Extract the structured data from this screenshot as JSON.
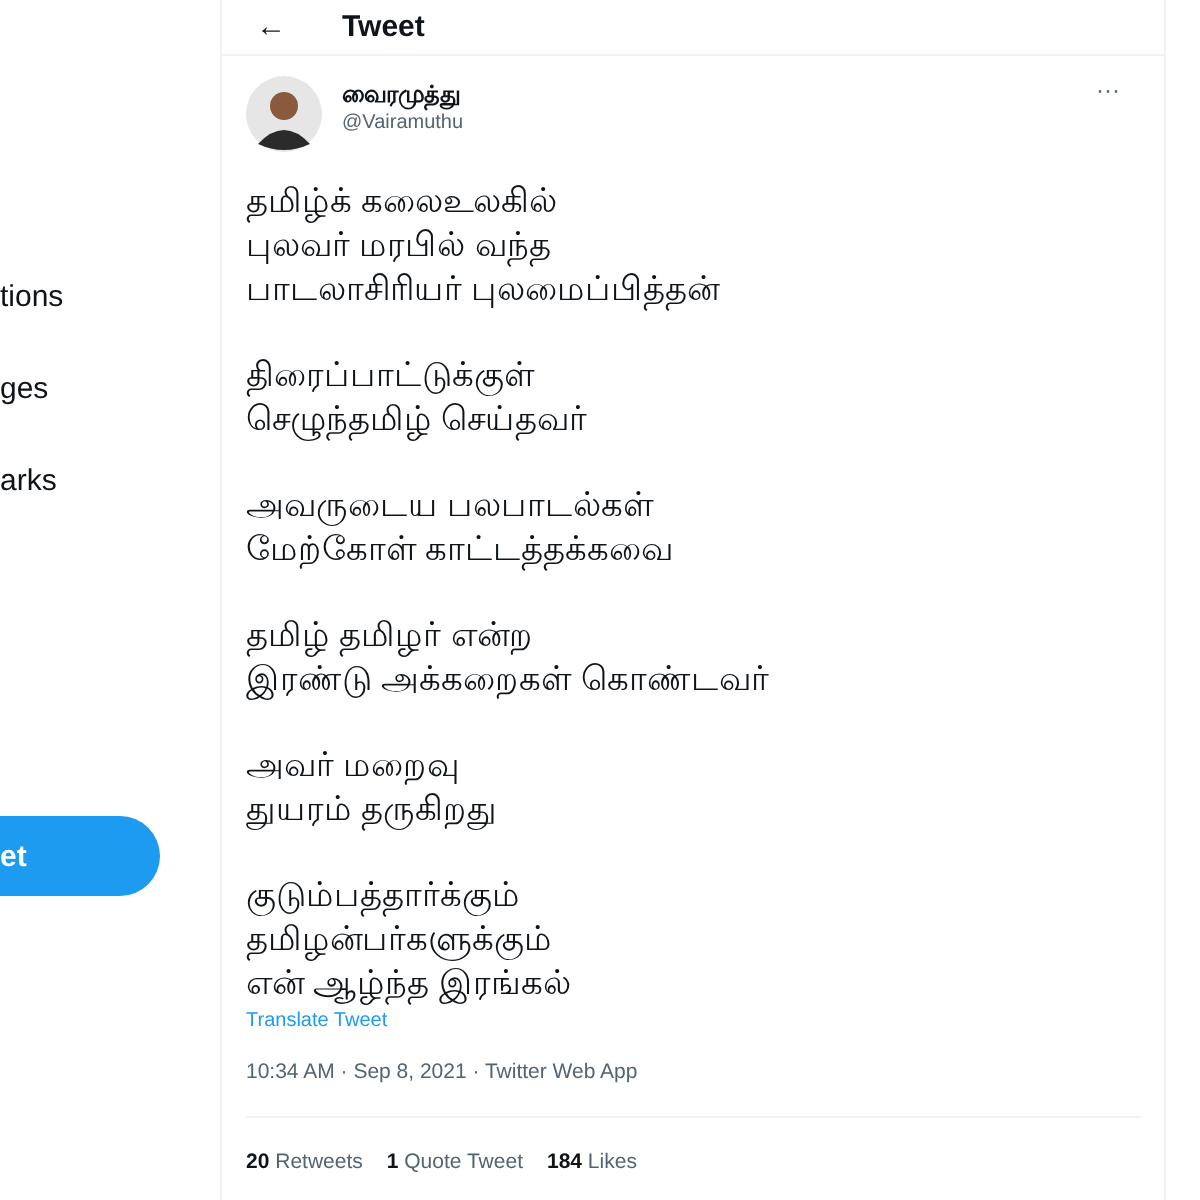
{
  "sidebar": {
    "items": [
      {
        "label": "tions"
      },
      {
        "label": "ges"
      },
      {
        "label": "arks"
      }
    ],
    "tweet_button": "et"
  },
  "header": {
    "back_icon": "←",
    "title": "Tweet"
  },
  "tweet": {
    "author_name": "வைரமுத்து",
    "handle": "@Vairamuthu",
    "more": "···",
    "paragraphs": [
      [
        "தமிழ்க் கலைஉலகில்",
        "புலவர் மரபில் வந்த",
        "பாடலாசிரியர் புலமைப்பித்தன்"
      ],
      [
        "திரைப்பாட்டுக்குள்",
        "செழுந்தமிழ் செய்தவர்"
      ],
      [
        "அவருடைய பலபாடல்கள்",
        "மேற்கோள் காட்டத்தக்கவை"
      ],
      [
        "தமிழ் தமிழர் என்ற",
        "இரண்டு அக்கறைகள் கொண்டவர்"
      ],
      [
        "அவர் மறைவு",
        "துயரம் தருகிறது"
      ],
      [
        "குடும்பத்தார்க்கும்",
        "தமிழன்பர்களுக்கும்",
        "என் ஆழ்ந்த இரங்கல்"
      ]
    ],
    "translate": "Translate Tweet",
    "meta": "10:34 AM · Sep 8, 2021 · Twitter Web App",
    "stats": [
      {
        "count": "20",
        "label": "Retweets"
      },
      {
        "count": "1",
        "label": "Quote Tweet"
      },
      {
        "count": "184",
        "label": "Likes"
      }
    ]
  }
}
